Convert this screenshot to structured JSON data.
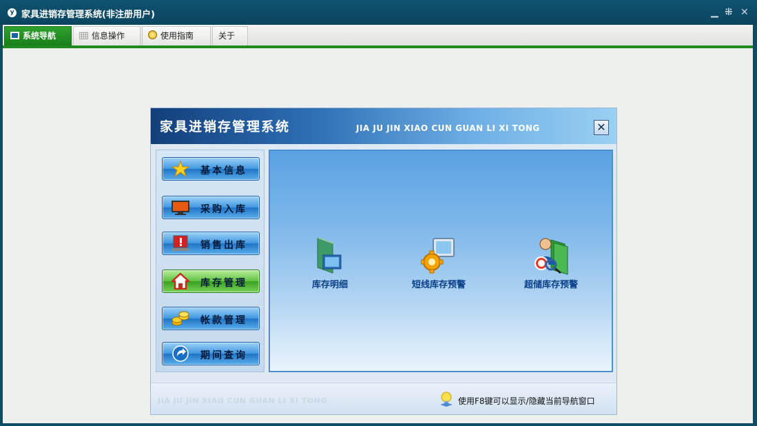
{
  "window": {
    "title": "家具进销存管理系统(非注册用户)",
    "app_icon_text": "y",
    "minimize": "▁",
    "restore": "⁜",
    "close": "✕"
  },
  "menu": {
    "items": [
      {
        "label": "系统导航",
        "icon": "monitor-icon",
        "active": true
      },
      {
        "label": "信息操作",
        "icon": "grid-icon",
        "active": false
      },
      {
        "label": "使用指南",
        "icon": "help-icon",
        "active": false
      },
      {
        "label": "关于",
        "icon": "",
        "active": false
      }
    ]
  },
  "panel": {
    "title": "家具进销存管理系统",
    "subtitle": "JIA JU JIN XIAO CUN  GUAN LI XI TONG",
    "close_label": "✕"
  },
  "nav": {
    "items": [
      {
        "label": "基本信息",
        "icon": "star-icon",
        "active": false
      },
      {
        "label": "采购入库",
        "icon": "monitor-icon",
        "active": false
      },
      {
        "label": "销售出库",
        "icon": "alert-icon",
        "active": false
      },
      {
        "label": "库存管理",
        "icon": "home-icon",
        "active": true
      },
      {
        "label": "帐款管理",
        "icon": "coins-icon",
        "active": false
      },
      {
        "label": "期间查询",
        "icon": "arrow-icon",
        "active": false
      }
    ]
  },
  "functions": [
    {
      "label": "库存明细",
      "icon": "panel-icon"
    },
    {
      "label": "短线库存预警",
      "icon": "gear-monitor-icon"
    },
    {
      "label": "超储库存预警",
      "icon": "user-book-icon"
    }
  ],
  "footer": {
    "watermark": "JIA JU JIN XIAO CUN GUAN LI XI TONG",
    "hint": "使用F8键可以显示/隐藏当前导航窗口"
  },
  "colors": {
    "title_bar": "#0e4c66",
    "active_tab": "#1e8a1e",
    "nav_button": "#3f96e0",
    "nav_button_active": "#5fc23f",
    "func_label": "#0a3f88"
  }
}
